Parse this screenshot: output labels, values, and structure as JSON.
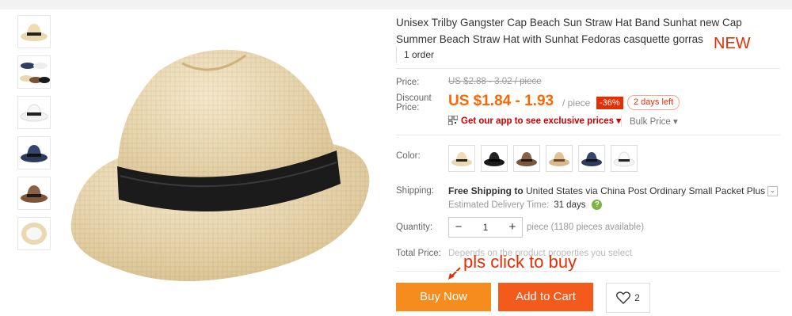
{
  "product": {
    "title": "Unisex Trilby Gangster Cap Beach Sun Straw Hat Band Sunhat new Cap Summer Beach Straw Hat with Sunhat Fedoras casquette gorras",
    "new_note": "NEW",
    "orders": "1 order"
  },
  "price": {
    "price_label": "Price:",
    "original": "US $2.88 - 3.02 / piece",
    "discount_label": "Discount Price:",
    "current": "US $1.84 - 1.93",
    "unit": "/ piece",
    "discount_badge": "-36%",
    "time_left": "2 days left",
    "app_promo": "Get our app to see exclusive prices ▾",
    "bulk_price": "Bulk Price ▾"
  },
  "options": {
    "color_label": "Color:",
    "colors": [
      "beige",
      "black",
      "brown",
      "khaki",
      "navy",
      "white"
    ],
    "shipping_label": "Shipping:",
    "shipping_bold": "Free Shipping to",
    "shipping_rest": "United States via China Post Ordinary Small Packet Plus",
    "delivery_label": "Estimated Delivery Time:",
    "delivery_days": "31 days",
    "quantity_label": "Quantity:",
    "quantity_value": "1",
    "quantity_note": "piece (1180 pieces available)",
    "total_label": "Total Price:",
    "total_note": "Depends on the product properties you select",
    "hand_note": "pls click to buy"
  },
  "actions": {
    "buy_now": "Buy Now",
    "add_to_cart": "Add to Cart",
    "wishlist_count": "2"
  },
  "colors": {
    "accent": "#f60",
    "buy": "#f68b1e",
    "cart": "#f55a1d",
    "badge": "#e62e04"
  },
  "icons": [
    "qr-code-icon",
    "heart-icon",
    "question-icon",
    "chevron-down-icon",
    "minus-icon",
    "plus-icon",
    "arrow-icon"
  ]
}
